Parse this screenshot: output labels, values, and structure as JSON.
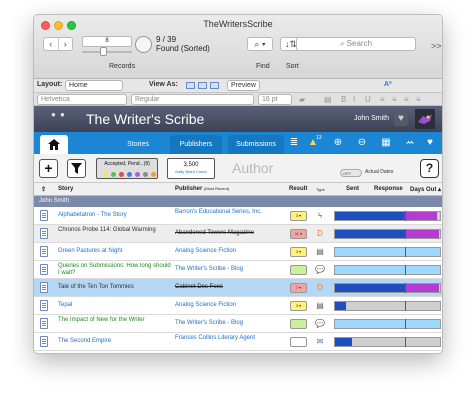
{
  "window": {
    "title": "TheWritersScribe"
  },
  "toolbar": {
    "record_number": "8",
    "found_count": "9 / 39",
    "found_label": "Found (Sorted)",
    "records_label": "Records",
    "find_label": "Find",
    "sort_label": "Sort",
    "search_placeholder": "Search",
    "more_label": ">>"
  },
  "layoutbar": {
    "layout_label": "Layout:",
    "layout_value": "Home",
    "view_as_label": "View As:",
    "preview_label": "Preview"
  },
  "formatbar": {
    "font": "Helvetica",
    "style": "Regular",
    "size": "16 pt"
  },
  "banner": {
    "title": "The Writer's Scribe",
    "user_name": "John Smith"
  },
  "tabs": [
    {
      "label": "Stories"
    },
    {
      "label": "Publishers"
    },
    {
      "label": "Submissions"
    }
  ],
  "tab_icons": [
    "home-icon",
    "list-icon",
    "alert-icon",
    "add-icon",
    "remove-icon",
    "grid-icon",
    "people-icon",
    "heart-icon",
    "gear-icon"
  ],
  "alert_badge": "13",
  "filter": {
    "status_text": "Accepted, Pend...(8)",
    "word_count": "3,500",
    "word_count_label": "Daily Word Count",
    "author_label": "Author",
    "toggle_label": "OFF",
    "actual_dates_label": "Actual Dates"
  },
  "columns": {
    "story": "Story",
    "publisher": "Publisher",
    "publisher_note": "(Most Recent)",
    "result": "Result",
    "type": "Type",
    "sent": "Sent",
    "response": "Response",
    "days_out": "Days Out"
  },
  "group": {
    "label": "John Smith"
  },
  "rows": [
    {
      "story": "Alphabetatron - The Story",
      "story_color": "blue",
      "publisher": "Barron's Educational Series, Inc.",
      "strike": false,
      "result": "3 ▾",
      "result_color": "#fff27a",
      "type": "slash-icon",
      "bar_fill": 0.97,
      "bar_colors": [
        "#1f4fbf",
        "#b43cd0"
      ],
      "mark": 0.67,
      "sel": false
    },
    {
      "story": "Chronos Probe 114: Global Warming",
      "story_color": "dark",
      "publisher": "Abandoned Towers Magazine",
      "strike": true,
      "result": "11 ▾",
      "result_color": "#f4a3a3",
      "type": "d-icon",
      "bar_fill": 0.99,
      "bar_colors": [
        "#1f4fbf",
        "#b43cd0"
      ],
      "mark": 0.67,
      "sel": false,
      "grey": true
    },
    {
      "story": "Green Pastures at Night",
      "story_color": "blue",
      "publisher": "Analog Science Fiction",
      "strike": false,
      "result": "3 ▾",
      "result_color": "#fff27a",
      "type": "form-icon",
      "bar_fill": 0.0,
      "bar_colors": [
        "#8fd0ff",
        "#8fd0ff"
      ],
      "mark": 0.67,
      "sel": false
    },
    {
      "story": "Queries on Submissions: How long should I wait?",
      "story_color": "green",
      "publisher": "The Writer's Scribe - Blog",
      "strike": false,
      "result": "",
      "result_color": "#c7f29a",
      "type": "bubble-icon",
      "bar_fill": 0.0,
      "bar_colors": [
        "#8fd0ff",
        "#8fd0ff"
      ],
      "mark": 0.67,
      "sel": false
    },
    {
      "story": "Tale of the Ten Ton Tommies",
      "story_color": "dark",
      "publisher": "Cabinet Des Fees",
      "strike": true,
      "result": "7 ▾",
      "result_color": "#f4a3a3",
      "type": "d-icon",
      "bar_fill": 0.99,
      "bar_colors": [
        "#1f4fbf",
        "#b43cd0"
      ],
      "mark": 0.67,
      "sel": true
    },
    {
      "story": "Tepal",
      "story_color": "blue",
      "publisher": "Analog Science Fiction",
      "strike": false,
      "result": "3 ▾",
      "result_color": "#fff27a",
      "type": "form-icon",
      "bar_fill": 0.1,
      "bar_colors": [
        "#1f4fbf",
        "#1f4fbf"
      ],
      "mark": 0.67,
      "sel": false
    },
    {
      "story": "The Impact of New for the Writer",
      "story_color": "green",
      "publisher": "The Writer's Scribe - Blog",
      "strike": false,
      "result": "",
      "result_color": "#c7f29a",
      "type": "bubble-icon",
      "bar_fill": 0.0,
      "bar_colors": [
        "#8fd0ff",
        "#8fd0ff"
      ],
      "mark": 0.67,
      "sel": false
    },
    {
      "story": "The Second Empire",
      "story_color": "blue",
      "publisher": "Frances Collins Literary Agent",
      "strike": false,
      "result": "",
      "result_color": "#ffffff",
      "type": "mail-icon",
      "bar_fill": 0.16,
      "bar_colors": [
        "#1f4fbf",
        "#1f4fbf"
      ],
      "mark": 0.67,
      "sel": false
    },
    {
      "story": "When to trunk, or retire, an artistic work?",
      "story_color": "green",
      "publisher": "The Writer's Scribe - Blog",
      "strike": false,
      "result": "",
      "result_color": "#c7f29a",
      "type": "bubble-icon",
      "bar_fill": 0.0,
      "bar_colors": [
        "#8fd0ff",
        "#8fd0ff"
      ],
      "mark": 0.67,
      "sel": false
    }
  ]
}
